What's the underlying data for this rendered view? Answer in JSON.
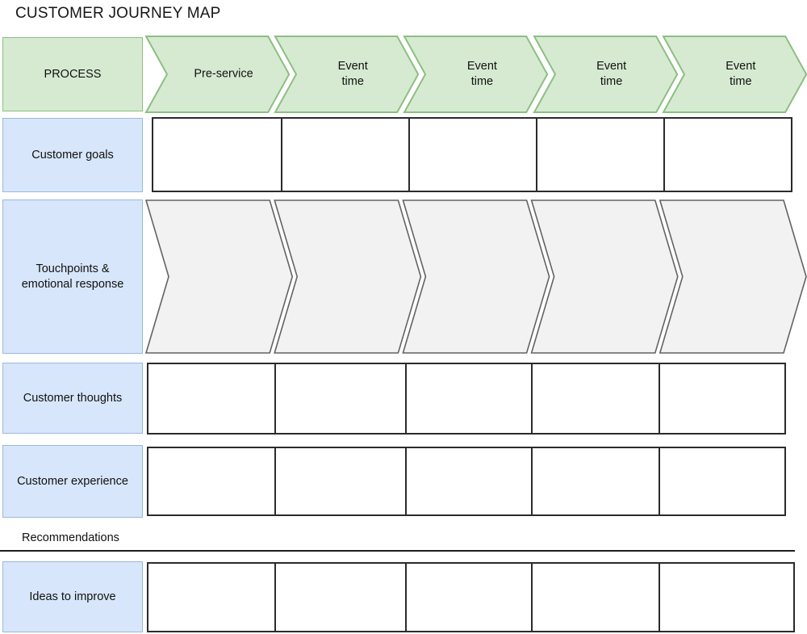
{
  "page": {
    "title": "CUSTOMER JOURNEY MAP"
  },
  "colors": {
    "process_fill": "#d6ead2",
    "process_border": "#8cbf80",
    "row_label_fill": "#d7e6fa",
    "row_label_border": "#9cb8dd",
    "touchpoint_fill": "#f2f2f2",
    "touchpoint_border": "#636363",
    "grid_border": "#2b2b2b",
    "text": "#111111"
  },
  "header": {
    "process_label": "PROCESS",
    "stages": [
      {
        "label": "Pre-service"
      },
      {
        "label": "Event\ntime"
      },
      {
        "label": "Event\ntime"
      },
      {
        "label": "Event\ntime"
      },
      {
        "label": "Event\ntime"
      }
    ]
  },
  "rows": [
    {
      "id": "customer-goals",
      "label": "Customer goals",
      "kind": "grid",
      "cells": [
        "",
        "",
        "",
        "",
        ""
      ]
    },
    {
      "id": "touchpoints",
      "label": "Touchpoints &\nemotional response",
      "kind": "chevron-band",
      "cells": [
        "",
        "",
        "",
        "",
        ""
      ]
    },
    {
      "id": "customer-thoughts",
      "label": "Customer thoughts",
      "kind": "grid",
      "cells": [
        "",
        "",
        "",
        "",
        ""
      ]
    },
    {
      "id": "customer-experience",
      "label": "Customer experience",
      "kind": "grid",
      "cells": [
        "",
        "",
        "",
        "",
        ""
      ]
    }
  ],
  "recommendations": {
    "section_label": "Recommendations",
    "row": {
      "id": "ideas-to-improve",
      "label": "Ideas to improve",
      "kind": "grid",
      "cells": [
        "",
        "",
        "",
        "",
        ""
      ]
    }
  }
}
